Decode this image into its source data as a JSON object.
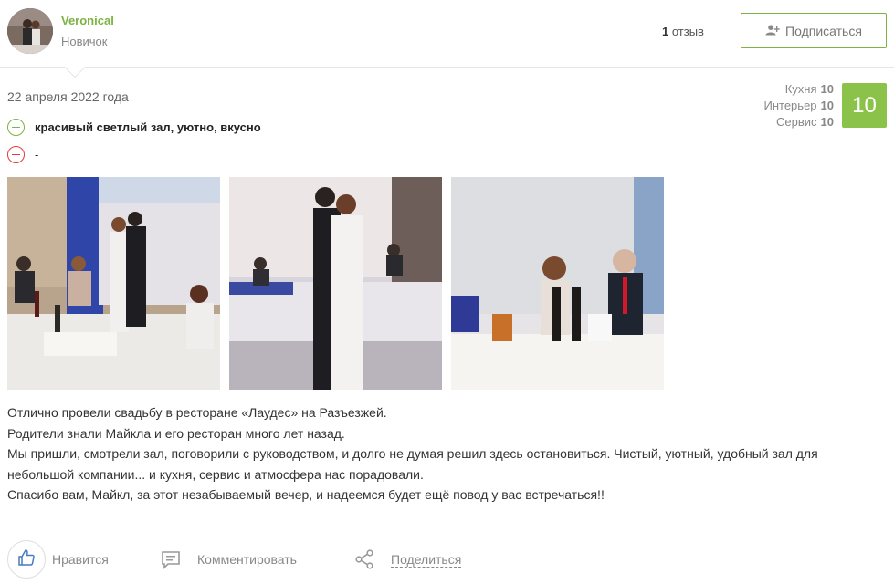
{
  "user": {
    "name": "Veronical",
    "rank": "Новичок",
    "review_count": "1",
    "review_word": "отзыв"
  },
  "subscribe_label": "Подписаться",
  "review": {
    "date": "22 апреля 2022 года",
    "ratings": [
      {
        "label": "Кухня",
        "value": "10"
      },
      {
        "label": "Интерьер",
        "value": "10"
      },
      {
        "label": "Сервис",
        "value": "10"
      }
    ],
    "score": "10",
    "pros": "красивый светлый зал, уютно, вкусно",
    "cons": "-",
    "paragraphs": [
      "Отлично провели свадьбу в ресторане «Лаудес» на Разъезжей.",
      "Родители знали Майкла и его ресторан много лет назад.",
      "Мы пришли, смотрели зал, поговорили с руководством, и долго не думая решил здесь остановиться. Чистый, уютный, удобный зал для небольшой компании... и кухня, сервис и атмосфера нас порадовали.",
      "Спасибо вам, Майкл, за этот незабываемый вечер, и надеемся будет ещё повод у вас встречаться!!"
    ]
  },
  "actions": {
    "like": "Нравится",
    "comment": "Комментировать",
    "share": "Поделиться"
  },
  "colors": {
    "accent_green": "#7cb342",
    "score_bg": "#8bc34a",
    "minus_red": "#e53935"
  },
  "icons": [
    "add-user-icon",
    "plus-circle-icon",
    "minus-circle-icon",
    "thumbs-up-icon",
    "comment-icon",
    "share-icon"
  ]
}
